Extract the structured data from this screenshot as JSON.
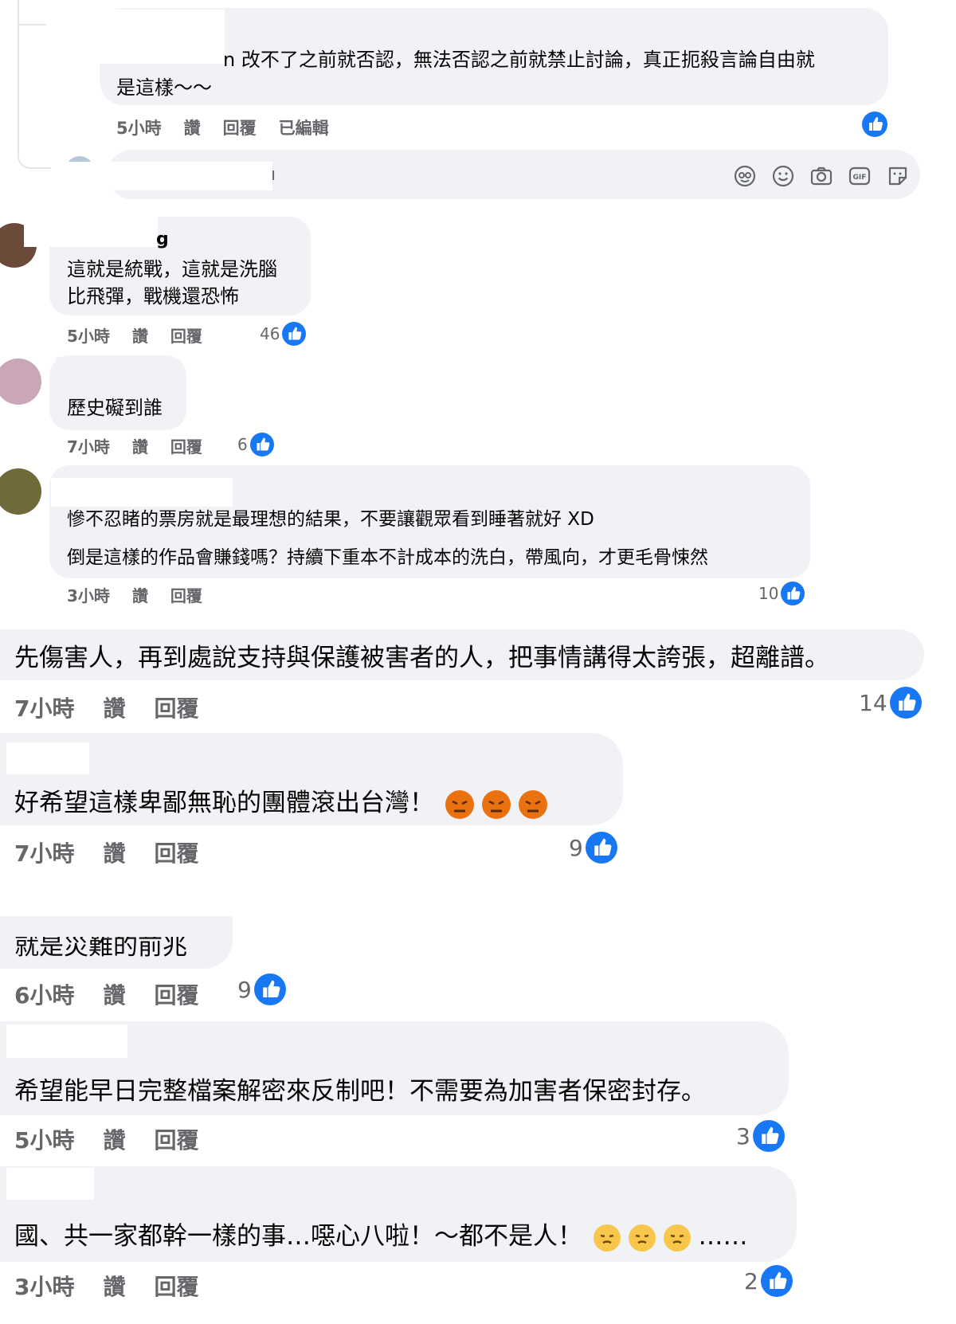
{
  "reply_comment": {
    "text_line1": "n 改不了之前就否認，無法否認之前就禁止討論，真正扼殺言論自由就",
    "text_line2": "是這樣～～",
    "time": "5小時",
    "like_label": "讚",
    "reply_label": "回覆",
    "edited_label": "已編輯"
  },
  "reply_input": {
    "placeholder": "ı",
    "icons": [
      "avatar-sticker-icon",
      "emoji-icon",
      "camera-icon",
      "gif-icon",
      "sticker-icon"
    ]
  },
  "comments": [
    {
      "name": "g",
      "lines": [
        "這就是統戰，這就是洗腦",
        "比飛彈，戰機還恐怖"
      ],
      "time": "5小時",
      "like_label": "讚",
      "reply_label": "回覆",
      "likes": "46"
    },
    {
      "name": "",
      "lines": [
        "歷史礙到誰"
      ],
      "time": "7小時",
      "like_label": "讚",
      "reply_label": "回覆",
      "likes": "6"
    },
    {
      "name": "",
      "lines": [
        "慘不忍睹的票房就是最理想的結果，不要讓觀眾看到睡著就好 XD",
        "倒是這樣的作品會賺錢嗎？持續下重本不計成本的洗白，帶風向，才更毛骨悚然"
      ],
      "time": "3小時",
      "like_label": "讚",
      "reply_label": "回覆",
      "likes": "10"
    },
    {
      "name": "",
      "lines": [
        "先傷害人，再到處說支持與保護被害者的人，把事情講得太誇張，超離譜。"
      ],
      "time": "7小時",
      "like_label": "讚",
      "reply_label": "回覆",
      "likes": "14"
    },
    {
      "name": "",
      "lines": [
        "好希望這樣卑鄙無恥的團體滾出台灣￼！"
      ],
      "time": "7小時",
      "like_label": "讚",
      "reply_label": "回覆",
      "likes": "9"
    },
    {
      "name": "",
      "lines": [
        "就是災難的前兆"
      ],
      "time": "6小時",
      "like_label": "讚",
      "reply_label": "回覆",
      "likes": "9"
    },
    {
      "name": "",
      "lines": [
        "希望能早日完整檔案解密來反制吧！不需要為加害者保密封存。"
      ],
      "time": "5小時",
      "like_label": "讚",
      "reply_label": "回覆",
      "likes": "3"
    },
    {
      "name": "",
      "lines": [
        "國、共一家都幹一樣的事…噁心八啦！～都不是人！",
        "……"
      ],
      "time": "3小時",
      "like_label": "讚",
      "reply_label": "回覆",
      "likes": "2"
    }
  ],
  "colors": {
    "bubble": "#f0f2f5",
    "meta_text": "#65676b",
    "like_blue": "#1877f2",
    "angry_emoji": "#e9710f",
    "steam_emoji": "#f7c64a"
  }
}
